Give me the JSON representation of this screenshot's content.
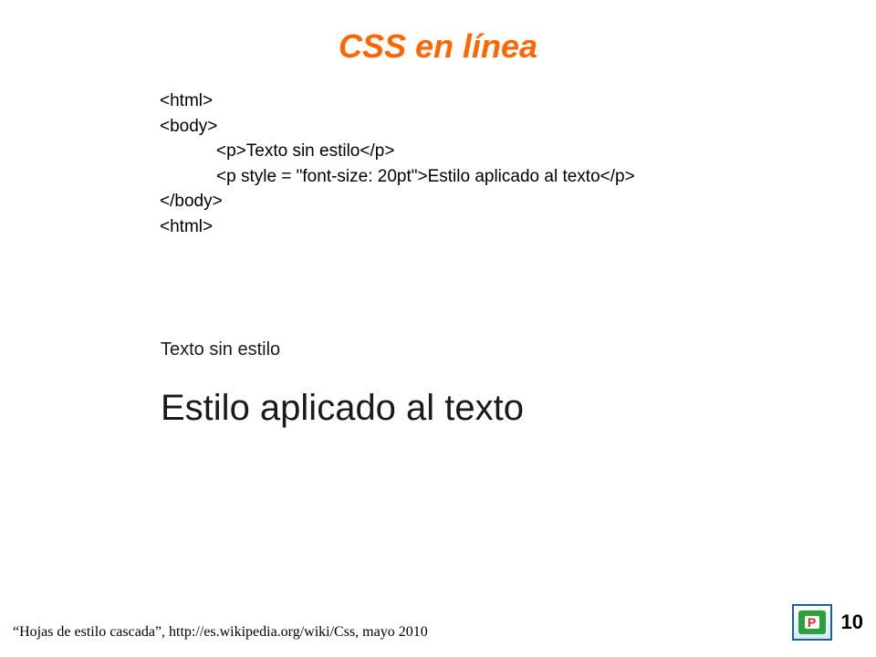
{
  "title": "CSS en línea",
  "code": {
    "line1": "<html>",
    "line2": "<body>",
    "line3": "<p>Texto sin estilo</p>",
    "line4": "<p style = \"font-size: 20pt\">Estilo aplicado al texto</p>",
    "line5": "</body>",
    "line6": "<html>"
  },
  "output": {
    "small_text": "Texto sin estilo",
    "large_text": "Estilo aplicado al texto"
  },
  "citation": "“Hojas de estilo cascada”, http://es.wikipedia.org/wiki/Css, mayo 2010",
  "page_number": "10"
}
